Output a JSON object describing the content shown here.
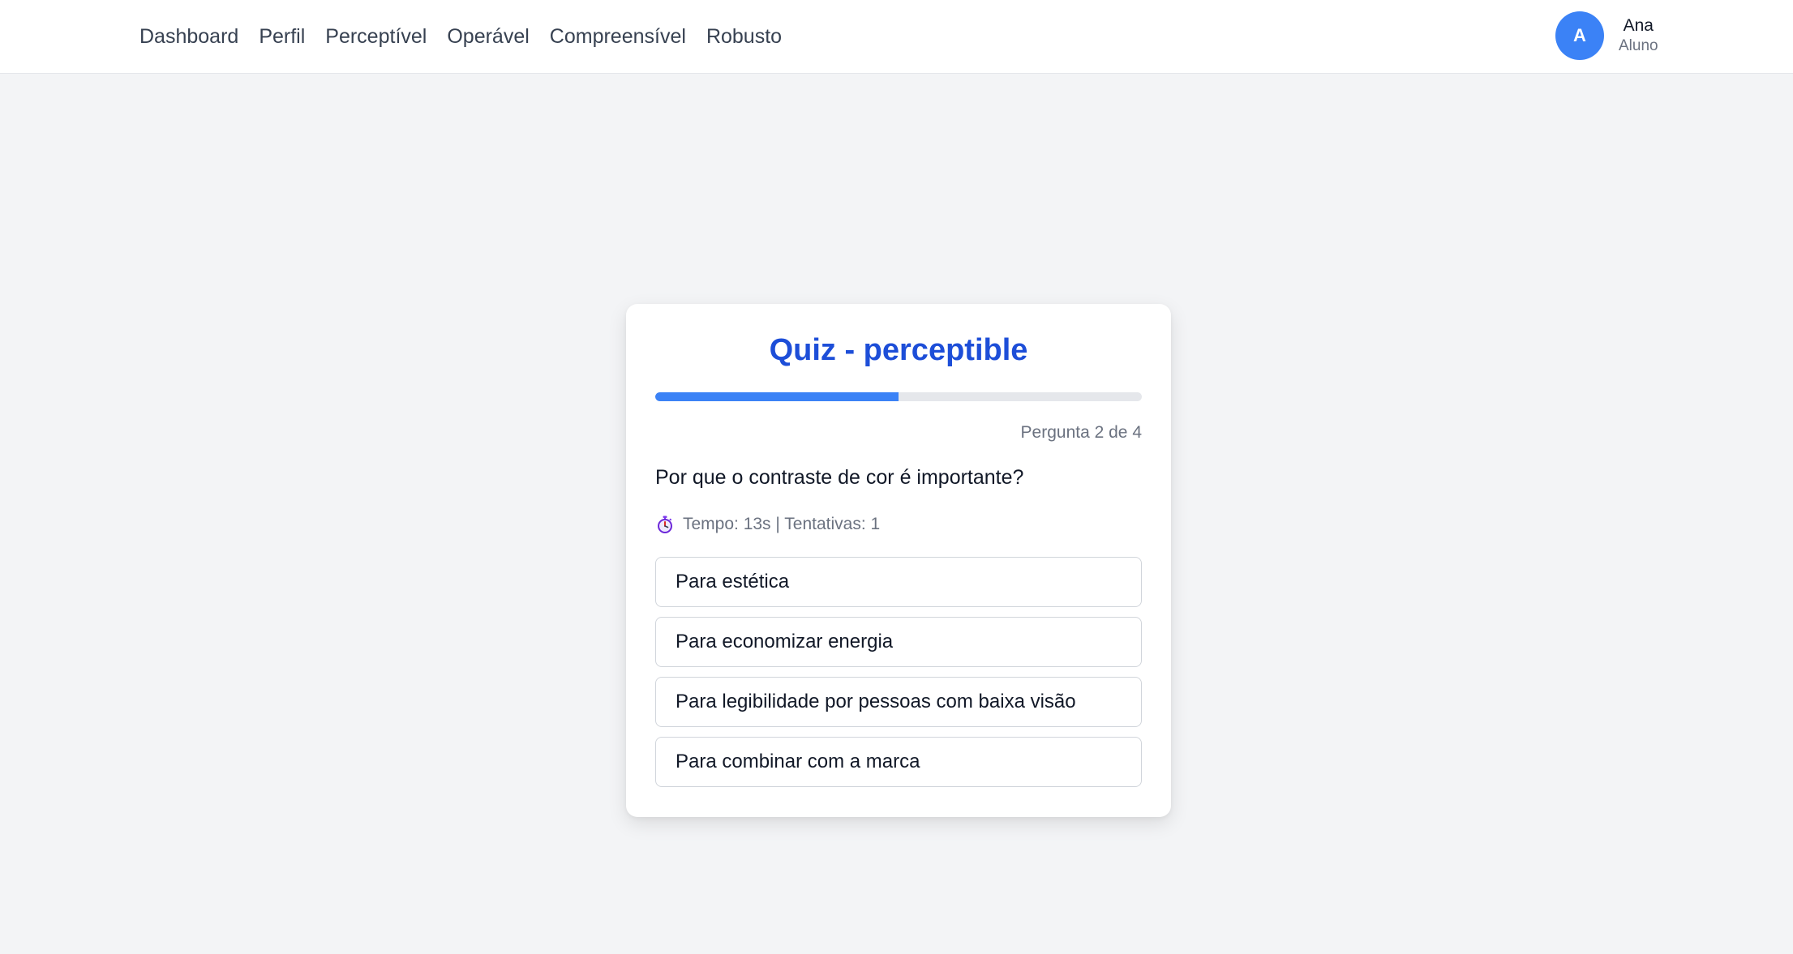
{
  "nav": {
    "items": [
      {
        "label": "Dashboard"
      },
      {
        "label": "Perfil"
      },
      {
        "label": "Perceptível"
      },
      {
        "label": "Operável"
      },
      {
        "label": "Compreensível"
      },
      {
        "label": "Robusto"
      }
    ]
  },
  "user": {
    "initial": "A",
    "name": "Ana",
    "role": "Aluno"
  },
  "quiz": {
    "title": "Quiz - perceptible",
    "progress": 0.5,
    "counter": "Pergunta 2 de 4",
    "question": "Por que o contraste de cor é importante?",
    "meta": "Tempo: 13s | Tentativas: 1",
    "timer_icon": "stopwatch-icon",
    "options": [
      {
        "label": "Para estética"
      },
      {
        "label": "Para economizar energia"
      },
      {
        "label": "Para legibilidade por pessoas com baixa visão"
      },
      {
        "label": "Para combinar com a marca"
      }
    ]
  },
  "colors": {
    "accent": "#3b82f6",
    "title": "#1d4ed8",
    "background": "#f3f4f6"
  }
}
